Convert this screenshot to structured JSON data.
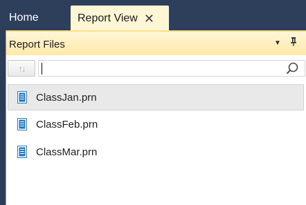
{
  "tabs": {
    "home_label": "Home",
    "active_label": "Report View",
    "close_glyph": "✕"
  },
  "panel": {
    "title": "Report Files",
    "dropdown_glyph": "▼",
    "pin_glyph": "ᛘ"
  },
  "toolbar": {
    "sort_glyph": "↑↓",
    "search_value": "",
    "search_placeholder": ""
  },
  "files": [
    {
      "name": "ClassJan.prn",
      "selected": true
    },
    {
      "name": "ClassFeb.prn",
      "selected": false
    },
    {
      "name": "ClassMar.prn",
      "selected": false
    }
  ],
  "colors": {
    "tab_bar": "#2e3f5c",
    "active_tab": "#fff6d6",
    "panel_header": "#ffe9a8",
    "file_icon": "#2a7ac0"
  }
}
